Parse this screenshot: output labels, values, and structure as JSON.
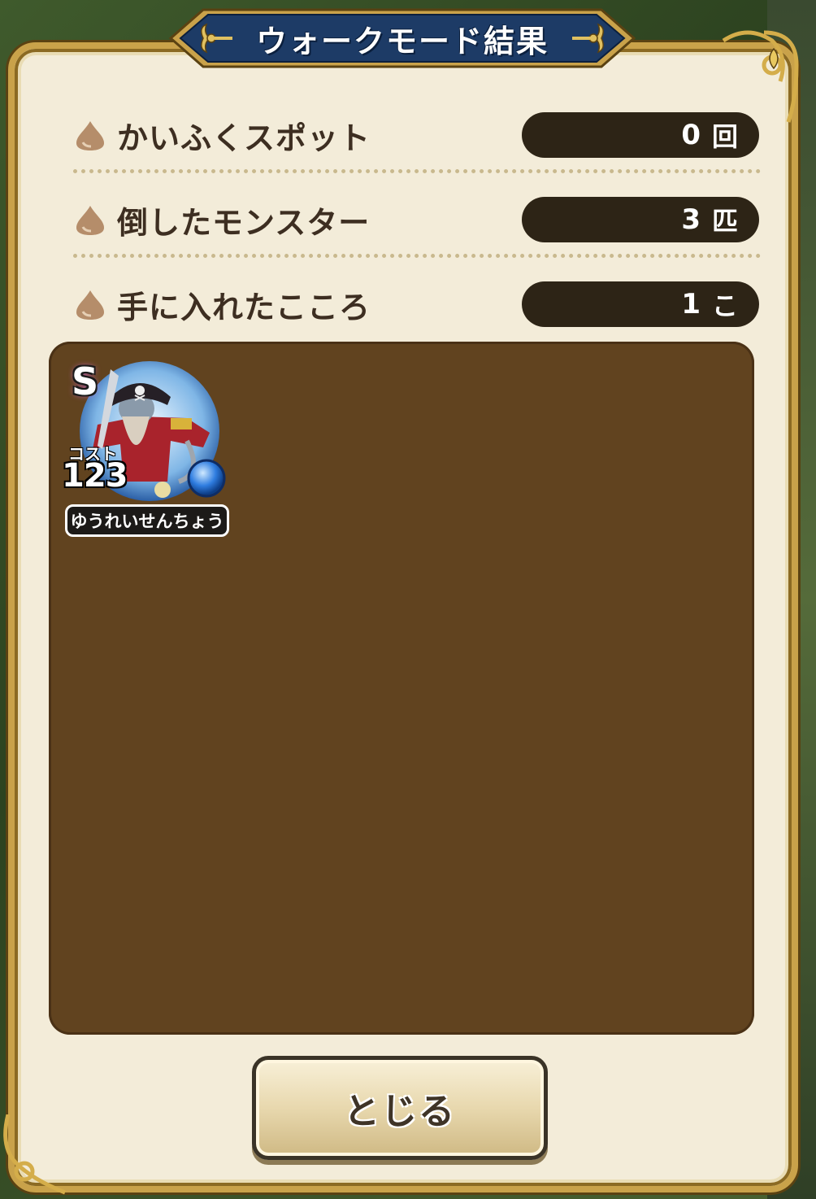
{
  "dialog": {
    "title": "ウォークモード結果"
  },
  "results": [
    {
      "label": "かいふくスポット",
      "value": "0",
      "unit": "回"
    },
    {
      "label": "倒したモンスター",
      "value": "3",
      "unit": "匹"
    },
    {
      "label": "手に入れたこころ",
      "value": "1",
      "unit": "こ"
    }
  ],
  "heart": {
    "rank": "S",
    "cost_label": "コスト",
    "cost_value": "123",
    "name": "ゆうれいせんちょう",
    "icon": "ghost-captain-portrait-icon"
  },
  "buttons": {
    "close_label": "とじる"
  },
  "colors": {
    "panel_bg": "#f3ecd9",
    "frame_gold": "#c9a24a",
    "title_navy": "#1d3b66",
    "value_box": "#2d2416",
    "monster_area": "#61431f",
    "label_text": "#3d2e21"
  }
}
